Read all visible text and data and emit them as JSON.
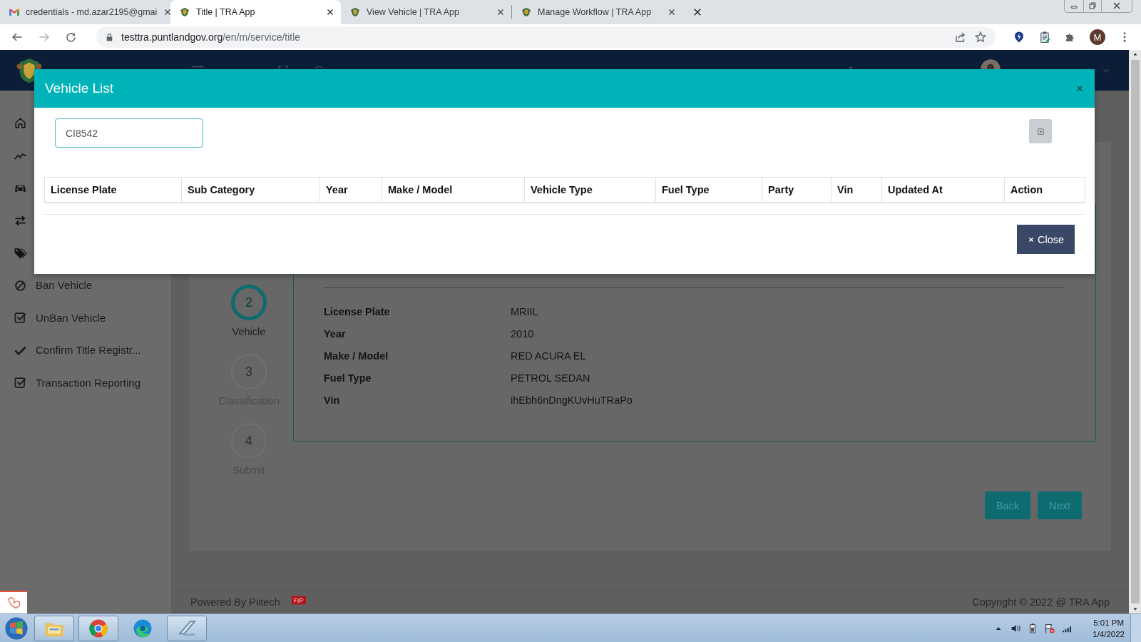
{
  "browser": {
    "tabs": [
      {
        "kind": "mail",
        "title": "credentials - md.azar2195@gmai",
        "selected": false
      },
      {
        "kind": "app",
        "title": "Title | TRA App",
        "selected": true
      },
      {
        "kind": "app",
        "title": "View Vehicle | TRA App",
        "selected": false
      },
      {
        "kind": "app",
        "title": "Manage Workflow | TRA App",
        "selected": false
      }
    ],
    "url_host": "testtra.puntlandgov.org",
    "url_path": "/en/m/service/title",
    "profile_initial": "M"
  },
  "sidebar": {
    "items": [
      {
        "kind": "home"
      },
      {
        "kind": "chart"
      },
      {
        "kind": "car"
      },
      {
        "kind": "transfer"
      },
      {
        "kind": "tags"
      },
      {
        "kind": "ban",
        "label": "Ban Vehicle"
      },
      {
        "kind": "check-square",
        "label": "UnBan Vehicle"
      },
      {
        "kind": "check",
        "label": "Confirm Title Registr..."
      },
      {
        "kind": "check-square",
        "label": "Transaction Reporting"
      }
    ]
  },
  "stepper": {
    "steps": [
      {
        "number": "2",
        "label": "Vehicle",
        "active": true
      },
      {
        "number": "3",
        "label": "Classification",
        "active": false
      },
      {
        "number": "4",
        "label": "Submit",
        "active": false
      }
    ]
  },
  "vehicle_details": {
    "rows": [
      {
        "label": "License Plate",
        "value": "MRIIL"
      },
      {
        "label": "Year",
        "value": "2010"
      },
      {
        "label": "Make / Model",
        "value": "RED ACURA EL"
      },
      {
        "label": "Fuel Type",
        "value": "PETROL SEDAN"
      },
      {
        "label": "Vin",
        "value": "ihEbh6nDngKUvHuTRaPo"
      }
    ]
  },
  "wizard_buttons": [
    "Back",
    "Next"
  ],
  "footer": {
    "powered_by": "Powered By Piitech",
    "copyright": "Copyright © 2022 @ TRA App"
  },
  "modal": {
    "title": "Vehicle List",
    "search": {
      "value": "CI8542"
    },
    "table": {
      "columns": [
        "License Plate",
        "Sub Category",
        "Year",
        "Make / Model",
        "Vehicle Type",
        "Fuel Type",
        "Party",
        "Vin",
        "Updated At",
        "Action"
      ]
    },
    "close_button": "Close"
  },
  "taskbar": {
    "time": "5:01 PM",
    "date": "1/4/2022"
  }
}
